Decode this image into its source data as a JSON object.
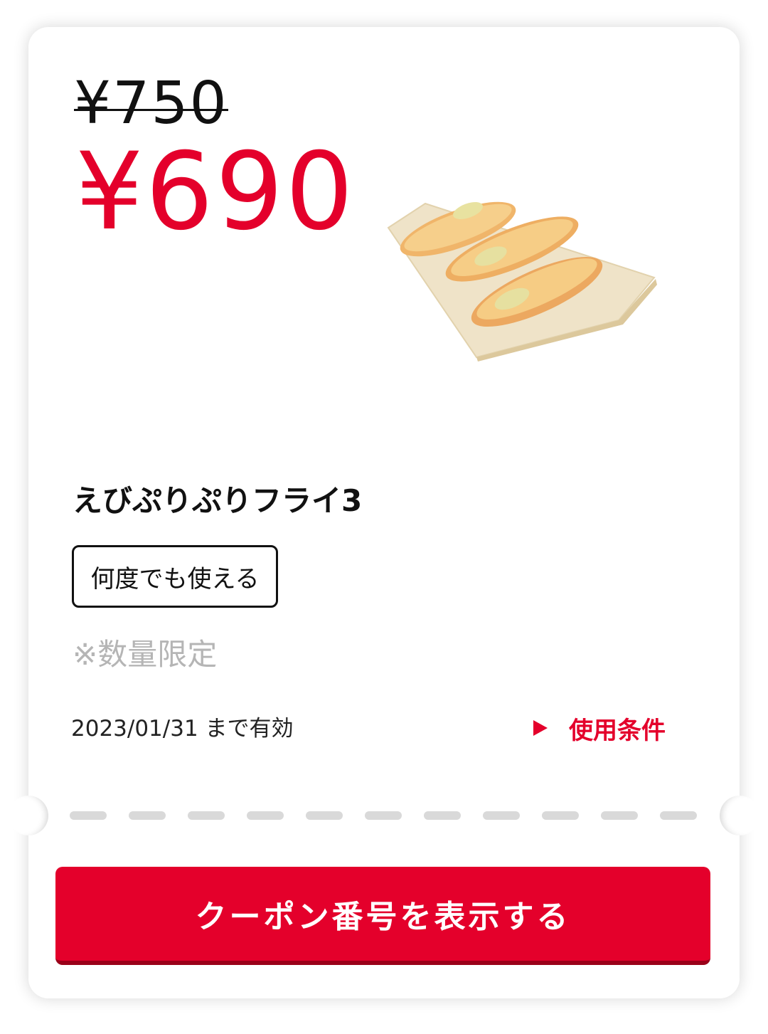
{
  "coupon": {
    "original_price": "¥750",
    "sale_price": "¥690",
    "product_name": "えびぷりぷりフライ3",
    "usage_tag": "何度でも使える",
    "note": "※数量限定",
    "validity": "2023/01/31 まで有効",
    "conditions_label": "使用条件",
    "button_label": "クーポン番号を表示する",
    "product_image": "fried-shrimp-image"
  },
  "colors": {
    "accent": "#e4002b",
    "text": "#111111",
    "muted": "#b5b5b5",
    "divider": "#d9d9d9"
  }
}
